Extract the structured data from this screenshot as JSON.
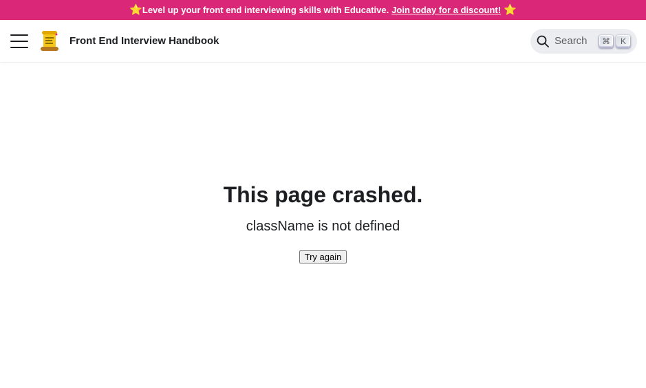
{
  "announcement": {
    "leading_star": "⭐",
    "text": "Level up your front end interviewing skills with Educative.",
    "link": "Join today for a discount!",
    "trailing_star": "⭐"
  },
  "navbar": {
    "menu_icon": "hamburger-menu-icon",
    "logo_icon": "scroll-logo-icon",
    "brand": "Front End Interview Handbook",
    "search": {
      "label": "Search",
      "key_modifier": "⌘",
      "key": "K"
    }
  },
  "error": {
    "title": "This page crashed.",
    "message": "className is not defined",
    "retry_label": "Try again"
  },
  "colors": {
    "announcement_bg": "#db2777",
    "text": "#1c1e21"
  }
}
